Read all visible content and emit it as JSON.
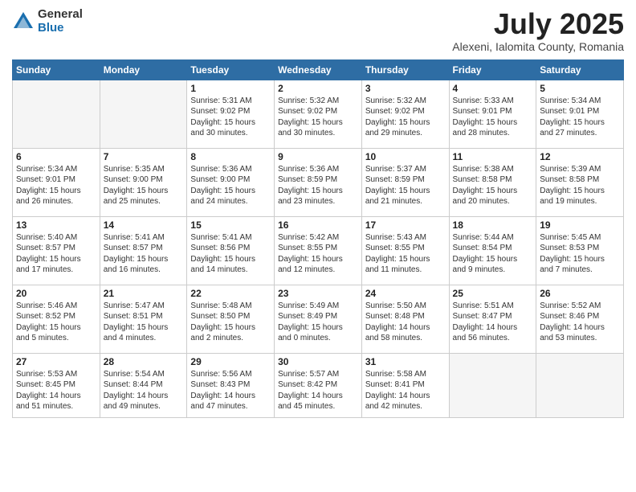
{
  "logo": {
    "general": "General",
    "blue": "Blue"
  },
  "title": "July 2025",
  "location": "Alexeni, Ialomita County, Romania",
  "weekdays": [
    "Sunday",
    "Monday",
    "Tuesday",
    "Wednesday",
    "Thursday",
    "Friday",
    "Saturday"
  ],
  "weeks": [
    [
      {
        "day": "",
        "info": ""
      },
      {
        "day": "",
        "info": ""
      },
      {
        "day": "1",
        "info": "Sunrise: 5:31 AM\nSunset: 9:02 PM\nDaylight: 15 hours\nand 30 minutes."
      },
      {
        "day": "2",
        "info": "Sunrise: 5:32 AM\nSunset: 9:02 PM\nDaylight: 15 hours\nand 30 minutes."
      },
      {
        "day": "3",
        "info": "Sunrise: 5:32 AM\nSunset: 9:02 PM\nDaylight: 15 hours\nand 29 minutes."
      },
      {
        "day": "4",
        "info": "Sunrise: 5:33 AM\nSunset: 9:01 PM\nDaylight: 15 hours\nand 28 minutes."
      },
      {
        "day": "5",
        "info": "Sunrise: 5:34 AM\nSunset: 9:01 PM\nDaylight: 15 hours\nand 27 minutes."
      }
    ],
    [
      {
        "day": "6",
        "info": "Sunrise: 5:34 AM\nSunset: 9:01 PM\nDaylight: 15 hours\nand 26 minutes."
      },
      {
        "day": "7",
        "info": "Sunrise: 5:35 AM\nSunset: 9:00 PM\nDaylight: 15 hours\nand 25 minutes."
      },
      {
        "day": "8",
        "info": "Sunrise: 5:36 AM\nSunset: 9:00 PM\nDaylight: 15 hours\nand 24 minutes."
      },
      {
        "day": "9",
        "info": "Sunrise: 5:36 AM\nSunset: 8:59 PM\nDaylight: 15 hours\nand 23 minutes."
      },
      {
        "day": "10",
        "info": "Sunrise: 5:37 AM\nSunset: 8:59 PM\nDaylight: 15 hours\nand 21 minutes."
      },
      {
        "day": "11",
        "info": "Sunrise: 5:38 AM\nSunset: 8:58 PM\nDaylight: 15 hours\nand 20 minutes."
      },
      {
        "day": "12",
        "info": "Sunrise: 5:39 AM\nSunset: 8:58 PM\nDaylight: 15 hours\nand 19 minutes."
      }
    ],
    [
      {
        "day": "13",
        "info": "Sunrise: 5:40 AM\nSunset: 8:57 PM\nDaylight: 15 hours\nand 17 minutes."
      },
      {
        "day": "14",
        "info": "Sunrise: 5:41 AM\nSunset: 8:57 PM\nDaylight: 15 hours\nand 16 minutes."
      },
      {
        "day": "15",
        "info": "Sunrise: 5:41 AM\nSunset: 8:56 PM\nDaylight: 15 hours\nand 14 minutes."
      },
      {
        "day": "16",
        "info": "Sunrise: 5:42 AM\nSunset: 8:55 PM\nDaylight: 15 hours\nand 12 minutes."
      },
      {
        "day": "17",
        "info": "Sunrise: 5:43 AM\nSunset: 8:55 PM\nDaylight: 15 hours\nand 11 minutes."
      },
      {
        "day": "18",
        "info": "Sunrise: 5:44 AM\nSunset: 8:54 PM\nDaylight: 15 hours\nand 9 minutes."
      },
      {
        "day": "19",
        "info": "Sunrise: 5:45 AM\nSunset: 8:53 PM\nDaylight: 15 hours\nand 7 minutes."
      }
    ],
    [
      {
        "day": "20",
        "info": "Sunrise: 5:46 AM\nSunset: 8:52 PM\nDaylight: 15 hours\nand 5 minutes."
      },
      {
        "day": "21",
        "info": "Sunrise: 5:47 AM\nSunset: 8:51 PM\nDaylight: 15 hours\nand 4 minutes."
      },
      {
        "day": "22",
        "info": "Sunrise: 5:48 AM\nSunset: 8:50 PM\nDaylight: 15 hours\nand 2 minutes."
      },
      {
        "day": "23",
        "info": "Sunrise: 5:49 AM\nSunset: 8:49 PM\nDaylight: 15 hours\nand 0 minutes."
      },
      {
        "day": "24",
        "info": "Sunrise: 5:50 AM\nSunset: 8:48 PM\nDaylight: 14 hours\nand 58 minutes."
      },
      {
        "day": "25",
        "info": "Sunrise: 5:51 AM\nSunset: 8:47 PM\nDaylight: 14 hours\nand 56 minutes."
      },
      {
        "day": "26",
        "info": "Sunrise: 5:52 AM\nSunset: 8:46 PM\nDaylight: 14 hours\nand 53 minutes."
      }
    ],
    [
      {
        "day": "27",
        "info": "Sunrise: 5:53 AM\nSunset: 8:45 PM\nDaylight: 14 hours\nand 51 minutes."
      },
      {
        "day": "28",
        "info": "Sunrise: 5:54 AM\nSunset: 8:44 PM\nDaylight: 14 hours\nand 49 minutes."
      },
      {
        "day": "29",
        "info": "Sunrise: 5:56 AM\nSunset: 8:43 PM\nDaylight: 14 hours\nand 47 minutes."
      },
      {
        "day": "30",
        "info": "Sunrise: 5:57 AM\nSunset: 8:42 PM\nDaylight: 14 hours\nand 45 minutes."
      },
      {
        "day": "31",
        "info": "Sunrise: 5:58 AM\nSunset: 8:41 PM\nDaylight: 14 hours\nand 42 minutes."
      },
      {
        "day": "",
        "info": ""
      },
      {
        "day": "",
        "info": ""
      }
    ]
  ]
}
